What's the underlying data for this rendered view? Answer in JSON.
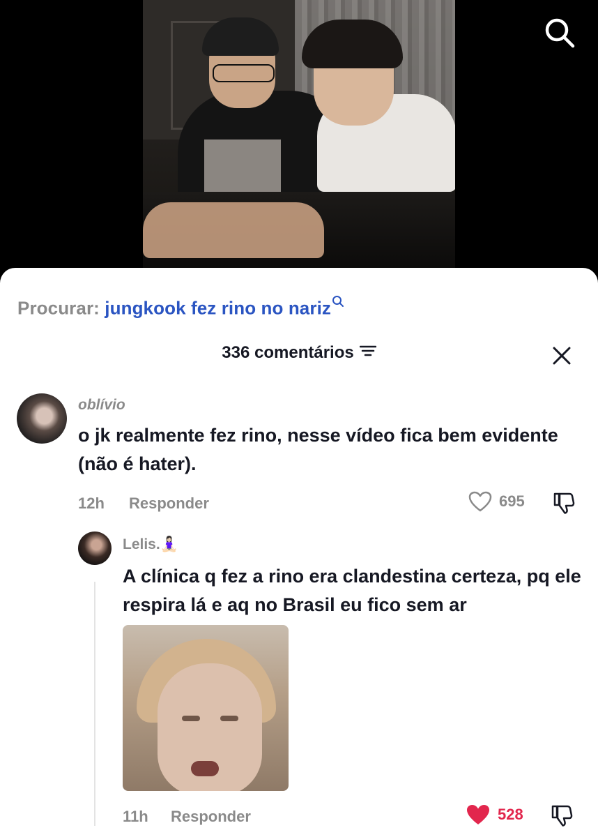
{
  "search_suggestion": {
    "label": "Procurar:",
    "query": "jungkook fez rino no nariz"
  },
  "comments_header": {
    "title": "336 comentários"
  },
  "comments": [
    {
      "username": "oblívio",
      "text": "o jk realmente fez rino, nesse vídeo fica bem evidente (não é hater).",
      "time": "12h",
      "reply_label": "Responder",
      "likes": "695",
      "liked": false
    },
    {
      "username": "Lelis.🧘🏻‍♀️",
      "text": "A clínica q fez a rino era clandestina certeza, pq ele respira lá e aq no Brasil eu fico sem ar",
      "time": "11h",
      "reply_label": "Responder",
      "likes": "528",
      "liked": true
    }
  ],
  "icons": {
    "search": "search-icon",
    "sort": "sort-icon",
    "close": "close-icon",
    "like": "heart-icon",
    "dislike": "thumbs-down-icon"
  },
  "colors": {
    "link_blue": "#2b55c2",
    "liked_red": "#e2264d",
    "muted_gray": "#8a8a8a",
    "text_dark": "#161823"
  }
}
